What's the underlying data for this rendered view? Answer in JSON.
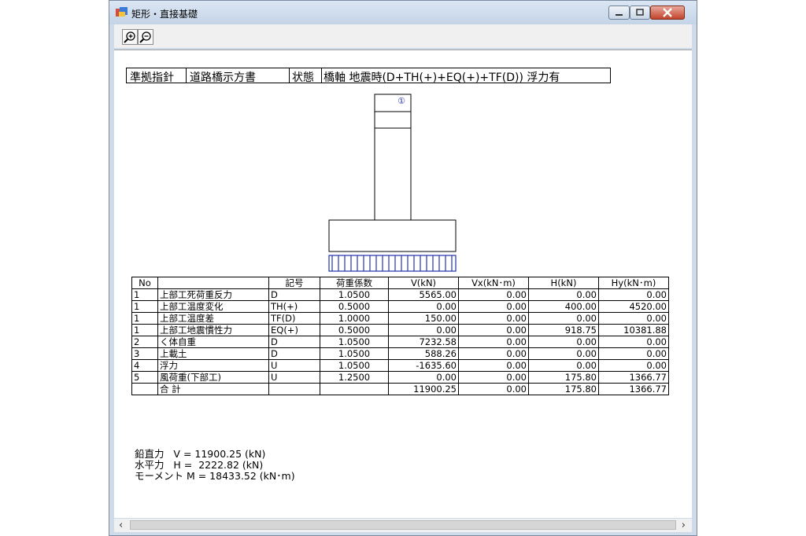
{
  "window": {
    "title": "矩形・直接基礎"
  },
  "toolbar": {
    "zoom_in": "zoom-in",
    "zoom_out": "zoom-out"
  },
  "header": {
    "label1": "準拠指針",
    "value1": "道路橋示方書",
    "label2": "状態",
    "value2": "橋軸 地震時(D+TH(+)+EQ(+)+TF(D)) 浮力有"
  },
  "diagram": {
    "marker": "①"
  },
  "table": {
    "headers": [
      "No",
      "",
      "記号",
      "荷重係数",
      "V(kN)",
      "Vx(kN･m)",
      "H(kN)",
      "Hy(kN･m)"
    ],
    "rows": [
      [
        "1",
        "上部工死荷重反力",
        "D",
        "1.0500",
        "5565.00",
        "0.00",
        "0.00",
        "0.00"
      ],
      [
        "1",
        "上部工温度変化",
        "TH(+)",
        "0.5000",
        "0.00",
        "0.00",
        "400.00",
        "4520.00"
      ],
      [
        "1",
        "上部工温度差",
        "TF(D)",
        "1.0000",
        "150.00",
        "0.00",
        "0.00",
        "0.00"
      ],
      [
        "1",
        "上部工地震慣性力",
        "EQ(+)",
        "0.5000",
        "0.00",
        "0.00",
        "918.75",
        "10381.88"
      ],
      [
        "2",
        "く体自重",
        "D",
        "1.0500",
        "7232.58",
        "0.00",
        "0.00",
        "0.00"
      ],
      [
        "3",
        " 上載土",
        "D",
        "1.0500",
        "588.26",
        "0.00",
        "0.00",
        "0.00"
      ],
      [
        "4",
        "浮力",
        "U",
        "1.0500",
        "-1635.60",
        "0.00",
        "0.00",
        "0.00"
      ],
      [
        "5",
        "風荷重(下部工)",
        "U",
        "1.2500",
        "0.00",
        "0.00",
        "175.80",
        "1366.77"
      ]
    ],
    "total": [
      "",
      "合 計",
      "",
      "",
      "11900.25",
      "0.00",
      "175.80",
      "1366.77"
    ]
  },
  "summary": {
    "line1": "鉛直力   V = 11900.25 (kN)",
    "line2": "水平力   H =  2222.82 (kN)",
    "line3": "モーメント M = 18433.52 (kN･m)"
  },
  "scroll": {
    "left": "‹",
    "right": "›"
  }
}
